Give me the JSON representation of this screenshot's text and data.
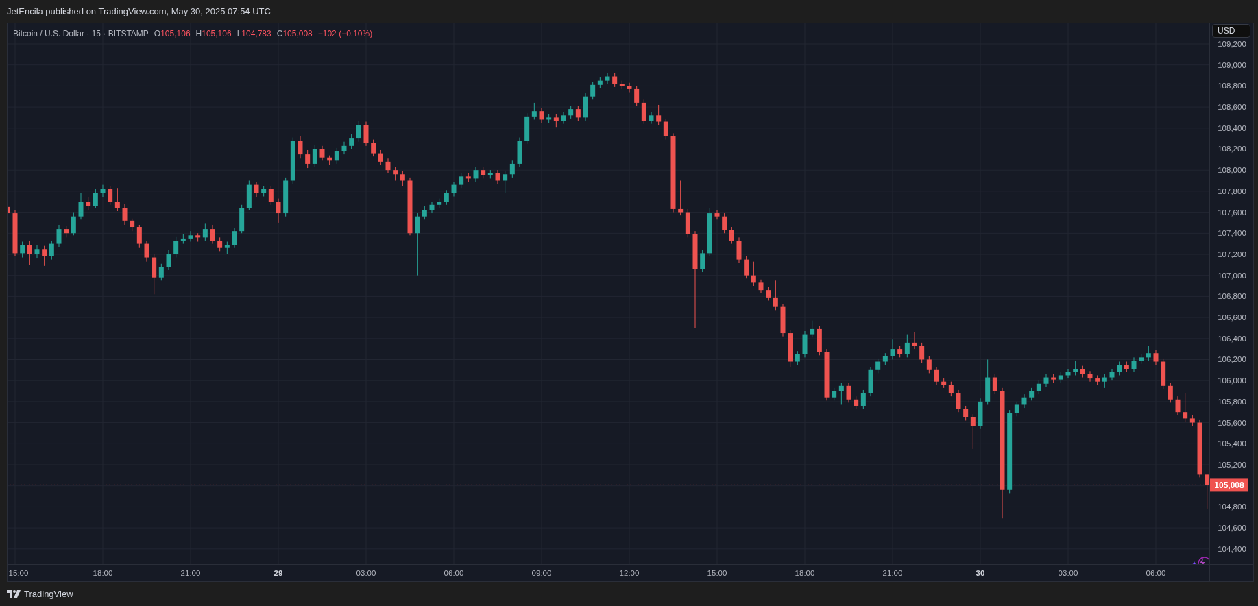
{
  "header": {
    "publisher_line": "JetEncila published on TradingView.com, May 30, 2025 07:54 UTC"
  },
  "legend": {
    "symbol": "Bitcoin / U.S. Dollar · 15 · BITSTAMP",
    "ohlc": [
      {
        "label": "O",
        "value": "105,106"
      },
      {
        "label": "H",
        "value": "105,106"
      },
      {
        "label": "L",
        "value": "104,783"
      },
      {
        "label": "C",
        "value": "105,008"
      }
    ],
    "change": "−102 (−0.10%)"
  },
  "currency_button": "USD",
  "chart_data": {
    "type": "candlestick",
    "yticks": [
      {
        "value": 109200,
        "label": "109,200"
      },
      {
        "value": 109000,
        "label": "109,000"
      },
      {
        "value": 108800,
        "label": "108,800"
      },
      {
        "value": 108600,
        "label": "108,600"
      },
      {
        "value": 108400,
        "label": "108,400"
      },
      {
        "value": 108200,
        "label": "108,200"
      },
      {
        "value": 108000,
        "label": "108,000"
      },
      {
        "value": 107800,
        "label": "107,800"
      },
      {
        "value": 107600,
        "label": "107,600"
      },
      {
        "value": 107400,
        "label": "107,400"
      },
      {
        "value": 107200,
        "label": "107,200"
      },
      {
        "value": 107000,
        "label": "107,000"
      },
      {
        "value": 106800,
        "label": "106,800"
      },
      {
        "value": 106600,
        "label": "106,600"
      },
      {
        "value": 106400,
        "label": "106,400"
      },
      {
        "value": 106200,
        "label": "106,200"
      },
      {
        "value": 106000,
        "label": "106,000"
      },
      {
        "value": 105800,
        "label": "105,800"
      },
      {
        "value": 105600,
        "label": "105,600"
      },
      {
        "value": 105400,
        "label": "105,400"
      },
      {
        "value": 105200,
        "label": "105,200"
      },
      {
        "value": 104800,
        "label": "104,800"
      },
      {
        "value": 104600,
        "label": "104,600"
      },
      {
        "value": 104400,
        "label": "104,400"
      }
    ],
    "ylim": [
      104255,
      109395
    ],
    "grid": true,
    "ref_lines": [
      {
        "axis": "y",
        "value": 105008,
        "label": "105,008",
        "color": "#ef5350"
      }
    ],
    "categories": [
      null,
      "15:00",
      null,
      null,
      null,
      null,
      null,
      null,
      null,
      null,
      null,
      null,
      null,
      "18:00",
      null,
      null,
      null,
      null,
      null,
      null,
      null,
      null,
      null,
      null,
      null,
      "21:00",
      null,
      null,
      null,
      null,
      null,
      null,
      null,
      null,
      null,
      null,
      null,
      "29",
      null,
      null,
      null,
      null,
      null,
      null,
      null,
      null,
      null,
      null,
      null,
      "03:00",
      null,
      null,
      null,
      null,
      null,
      null,
      null,
      null,
      null,
      null,
      null,
      "06:00",
      null,
      null,
      null,
      null,
      null,
      null,
      null,
      null,
      null,
      null,
      null,
      "09:00",
      null,
      null,
      null,
      null,
      null,
      null,
      null,
      null,
      null,
      null,
      null,
      "12:00",
      null,
      null,
      null,
      null,
      null,
      null,
      null,
      null,
      null,
      null,
      null,
      "15:00",
      null,
      null,
      null,
      null,
      null,
      null,
      null,
      null,
      null,
      null,
      null,
      "18:00",
      null,
      null,
      null,
      null,
      null,
      null,
      null,
      null,
      null,
      null,
      null,
      "21:00",
      null,
      null,
      null,
      null,
      null,
      null,
      null,
      null,
      null,
      null,
      null,
      "30",
      null,
      null,
      null,
      null,
      null,
      null,
      null,
      null,
      null,
      null,
      null,
      "03:00",
      null,
      null,
      null,
      null,
      null,
      null,
      null,
      null,
      null,
      null,
      null,
      "06:00",
      null,
      null,
      null,
      null,
      null,
      null,
      null
    ],
    "ohlc": [
      [
        107650,
        107880,
        107560,
        107590
      ],
      [
        107590,
        107620,
        107180,
        107210
      ],
      [
        107210,
        107320,
        107170,
        107290
      ],
      [
        107290,
        107330,
        107100,
        107200
      ],
      [
        107200,
        107290,
        107160,
        107250
      ],
      [
        107250,
        107280,
        107090,
        107180
      ],
      [
        107180,
        107330,
        107150,
        107300
      ],
      [
        107300,
        107480,
        107270,
        107440
      ],
      [
        107440,
        107470,
        107360,
        107400
      ],
      [
        107400,
        107600,
        107380,
        107560
      ],
      [
        107560,
        107780,
        107530,
        107700
      ],
      [
        107700,
        107740,
        107620,
        107660
      ],
      [
        107660,
        107820,
        107640,
        107780
      ],
      [
        107780,
        107860,
        107740,
        107820
      ],
      [
        107820,
        107850,
        107670,
        107700
      ],
      [
        107700,
        107830,
        107610,
        107640
      ],
      [
        107640,
        107680,
        107480,
        107520
      ],
      [
        107520,
        107540,
        107420,
        107460
      ],
      [
        107460,
        107480,
        107260,
        107300
      ],
      [
        107300,
        107330,
        107130,
        107170
      ],
      [
        107170,
        107200,
        106820,
        106980
      ],
      [
        106980,
        107110,
        106950,
        107080
      ],
      [
        107080,
        107240,
        107050,
        107200
      ],
      [
        107200,
        107370,
        107170,
        107330
      ],
      [
        107330,
        107390,
        107300,
        107350
      ],
      [
        107350,
        107420,
        107320,
        107380
      ],
      [
        107380,
        107400,
        107320,
        107360
      ],
      [
        107360,
        107490,
        107330,
        107440
      ],
      [
        107440,
        107480,
        107300,
        107330
      ],
      [
        107330,
        107360,
        107230,
        107260
      ],
      [
        107260,
        107320,
        107200,
        107290
      ],
      [
        107290,
        107450,
        107260,
        107420
      ],
      [
        107420,
        107670,
        107400,
        107640
      ],
      [
        107640,
        107900,
        107620,
        107860
      ],
      [
        107860,
        107890,
        107740,
        107780
      ],
      [
        107780,
        107850,
        107750,
        107820
      ],
      [
        107820,
        107850,
        107670,
        107700
      ],
      [
        107700,
        107730,
        107500,
        107590
      ],
      [
        107590,
        107930,
        107560,
        107900
      ],
      [
        107900,
        108310,
        107870,
        108280
      ],
      [
        108280,
        108320,
        108110,
        108150
      ],
      [
        108150,
        108190,
        108020,
        108060
      ],
      [
        108060,
        108240,
        108030,
        108200
      ],
      [
        108200,
        108230,
        108090,
        108120
      ],
      [
        108120,
        108140,
        108050,
        108090
      ],
      [
        108090,
        108210,
        108060,
        108180
      ],
      [
        108180,
        108270,
        108150,
        108230
      ],
      [
        108230,
        108340,
        108200,
        108300
      ],
      [
        108300,
        108470,
        108270,
        108430
      ],
      [
        108430,
        108460,
        108230,
        108260
      ],
      [
        108260,
        108290,
        108130,
        108160
      ],
      [
        108160,
        108190,
        108050,
        108080
      ],
      [
        108080,
        108110,
        107970,
        108000
      ],
      [
        108000,
        108030,
        107900,
        107960
      ],
      [
        107960,
        107990,
        107850,
        107900
      ],
      [
        107900,
        107930,
        107380,
        107400
      ],
      [
        107400,
        107590,
        107000,
        107560
      ],
      [
        107560,
        107660,
        107530,
        107620
      ],
      [
        107620,
        107700,
        107590,
        107670
      ],
      [
        107670,
        107730,
        107640,
        107700
      ],
      [
        107700,
        107810,
        107670,
        107780
      ],
      [
        107780,
        107890,
        107750,
        107860
      ],
      [
        107860,
        107970,
        107830,
        107940
      ],
      [
        107940,
        107970,
        107890,
        107920
      ],
      [
        107920,
        108030,
        107890,
        108000
      ],
      [
        108000,
        108030,
        107920,
        107950
      ],
      [
        107950,
        108000,
        107920,
        107970
      ],
      [
        107970,
        108000,
        107870,
        107900
      ],
      [
        107900,
        107990,
        107780,
        107960
      ],
      [
        107960,
        108090,
        107930,
        108060
      ],
      [
        108060,
        108310,
        108030,
        108280
      ],
      [
        108280,
        108540,
        108250,
        108510
      ],
      [
        108510,
        108640,
        108480,
        108560
      ],
      [
        108560,
        108590,
        108450,
        108480
      ],
      [
        108480,
        108530,
        108450,
        108500
      ],
      [
        108500,
        108530,
        108410,
        108470
      ],
      [
        108470,
        108550,
        108440,
        108520
      ],
      [
        108520,
        108610,
        108490,
        108580
      ],
      [
        108580,
        108610,
        108470,
        108500
      ],
      [
        108500,
        108730,
        108470,
        108700
      ],
      [
        108700,
        108840,
        108670,
        108810
      ],
      [
        108810,
        108880,
        108780,
        108850
      ],
      [
        108850,
        108920,
        108820,
        108890
      ],
      [
        108890,
        108920,
        108790,
        108820
      ],
      [
        108820,
        108850,
        108770,
        108800
      ],
      [
        108800,
        108830,
        108740,
        108770
      ],
      [
        108770,
        108800,
        108610,
        108640
      ],
      [
        108640,
        108670,
        108440,
        108470
      ],
      [
        108470,
        108550,
        108440,
        108520
      ],
      [
        108520,
        108620,
        108430,
        108460
      ],
      [
        108460,
        108490,
        108290,
        108320
      ],
      [
        108320,
        108350,
        107600,
        107630
      ],
      [
        107630,
        107900,
        107570,
        107600
      ],
      [
        107600,
        107630,
        107360,
        107390
      ],
      [
        107390,
        107420,
        106500,
        107060
      ],
      [
        107060,
        107240,
        107030,
        107210
      ],
      [
        107210,
        107640,
        107180,
        107590
      ],
      [
        107590,
        107620,
        107530,
        107560
      ],
      [
        107560,
        107590,
        107400,
        107430
      ],
      [
        107430,
        107460,
        107300,
        107330
      ],
      [
        107330,
        107360,
        107120,
        107150
      ],
      [
        107150,
        107180,
        106970,
        107000
      ],
      [
        107000,
        107130,
        106900,
        106930
      ],
      [
        106930,
        106960,
        106830,
        106860
      ],
      [
        106860,
        106890,
        106760,
        106790
      ],
      [
        106790,
        106950,
        106670,
        106700
      ],
      [
        106700,
        106730,
        106420,
        106450
      ],
      [
        106450,
        106480,
        106130,
        106180
      ],
      [
        106180,
        106280,
        106150,
        106250
      ],
      [
        106250,
        106470,
        106220,
        106440
      ],
      [
        106440,
        106570,
        106410,
        106490
      ],
      [
        106490,
        106520,
        106240,
        106270
      ],
      [
        106270,
        106300,
        105810,
        105840
      ],
      [
        105840,
        105930,
        105810,
        105900
      ],
      [
        105900,
        105980,
        105770,
        105950
      ],
      [
        105950,
        105980,
        105790,
        105820
      ],
      [
        105820,
        105850,
        105730,
        105760
      ],
      [
        105760,
        105910,
        105730,
        105880
      ],
      [
        105880,
        106130,
        105850,
        106100
      ],
      [
        106100,
        106210,
        106070,
        106180
      ],
      [
        106180,
        106260,
        106150,
        106230
      ],
      [
        106230,
        106390,
        106200,
        106300
      ],
      [
        106300,
        106330,
        106220,
        106250
      ],
      [
        106250,
        106440,
        106220,
        106360
      ],
      [
        106360,
        106460,
        106300,
        106330
      ],
      [
        106330,
        106360,
        106170,
        106200
      ],
      [
        106200,
        106230,
        106070,
        106100
      ],
      [
        106100,
        106130,
        105960,
        105990
      ],
      [
        105990,
        106020,
        105930,
        105960
      ],
      [
        105960,
        105990,
        105850,
        105880
      ],
      [
        105880,
        105910,
        105700,
        105730
      ],
      [
        105730,
        105760,
        105620,
        105650
      ],
      [
        105650,
        105680,
        105350,
        105570
      ],
      [
        105570,
        105830,
        105540,
        105800
      ],
      [
        105800,
        106200,
        105770,
        106030
      ],
      [
        106030,
        106060,
        105870,
        105900
      ],
      [
        105900,
        105930,
        104690,
        104960
      ],
      [
        104960,
        105720,
        104930,
        105690
      ],
      [
        105690,
        105800,
        105660,
        105770
      ],
      [
        105770,
        105870,
        105740,
        105840
      ],
      [
        105840,
        105930,
        105810,
        105900
      ],
      [
        105900,
        106000,
        105870,
        105970
      ],
      [
        105970,
        106060,
        105940,
        106030
      ],
      [
        106030,
        106060,
        105980,
        106010
      ],
      [
        106010,
        106080,
        105980,
        106050
      ],
      [
        106050,
        106110,
        106020,
        106080
      ],
      [
        106080,
        106190,
        106050,
        106110
      ],
      [
        106110,
        106140,
        106030,
        106060
      ],
      [
        106060,
        106090,
        105990,
        106020
      ],
      [
        106020,
        106050,
        105960,
        105990
      ],
      [
        105990,
        106060,
        105930,
        106030
      ],
      [
        106030,
        106110,
        106000,
        106080
      ],
      [
        106080,
        106180,
        106050,
        106150
      ],
      [
        106150,
        106180,
        106080,
        106110
      ],
      [
        106110,
        106220,
        106080,
        106190
      ],
      [
        106190,
        106250,
        106160,
        106220
      ],
      [
        106220,
        106330,
        106190,
        106260
      ],
      [
        106260,
        106290,
        106150,
        106180
      ],
      [
        106180,
        106210,
        105920,
        105950
      ],
      [
        105950,
        105980,
        105790,
        105820
      ],
      [
        105820,
        105850,
        105670,
        105700
      ],
      [
        105700,
        105880,
        105610,
        105640
      ],
      [
        105640,
        105670,
        105570,
        105600
      ],
      [
        105600,
        105630,
        105080,
        105106
      ],
      [
        105106,
        105106,
        104783,
        105008
      ]
    ]
  },
  "time_axis": {
    "ticks": [
      {
        "day": false
      },
      {
        "day": false
      },
      {
        "day": false
      },
      {
        "day": true
      },
      {
        "day": false
      },
      {
        "day": false
      },
      {
        "day": false
      },
      {
        "day": false
      },
      {
        "day": false
      },
      {
        "day": false
      },
      {
        "day": false
      },
      {
        "day": true
      },
      {
        "day": false
      },
      {
        "day": false
      }
    ]
  },
  "footer": {
    "brand": "TradingView"
  }
}
